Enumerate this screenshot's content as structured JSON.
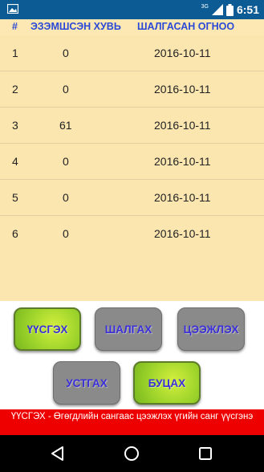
{
  "status_bar": {
    "time": "6:51",
    "network_label": "3G",
    "icons": [
      "image-notification-icon",
      "signal-icon",
      "battery-icon"
    ]
  },
  "table": {
    "headers": [
      "#",
      "ЭЗЭМШСЭН ХУВЬ",
      "ШАЛГАСАН ОГНОО"
    ],
    "rows": [
      {
        "num": "1",
        "share": "0",
        "date": "2016-10-11"
      },
      {
        "num": "2",
        "share": "0",
        "date": "2016-10-11"
      },
      {
        "num": "3",
        "share": "61",
        "date": "2016-10-11"
      },
      {
        "num": "4",
        "share": "0",
        "date": "2016-10-11"
      },
      {
        "num": "5",
        "share": "0",
        "date": "2016-10-11"
      },
      {
        "num": "6",
        "share": "0",
        "date": "2016-10-11"
      }
    ]
  },
  "buttons": {
    "create": "ҮҮСГЭХ",
    "check": "ШАЛГАХ",
    "save": "ЦЭЭЖЛЭХ",
    "delete": "УСТГАХ",
    "back": "БУЦАХ"
  },
  "hint": "ҮҮСГЭХ - Өгөгдлийн сангаас цээжлэх үгийн санг үүсгэнэ",
  "colors": {
    "status_bar": "#0c5b94",
    "table_bg": "#fbe6b0",
    "header_text": "#2a49d6",
    "button_text": "#3b2fd8",
    "green_button": "#9ed42b",
    "grey_button": "#8a8a8a",
    "hint_bg": "#ee0000"
  },
  "nav": [
    "back-triangle-icon",
    "home-circle-icon",
    "recents-square-icon"
  ]
}
